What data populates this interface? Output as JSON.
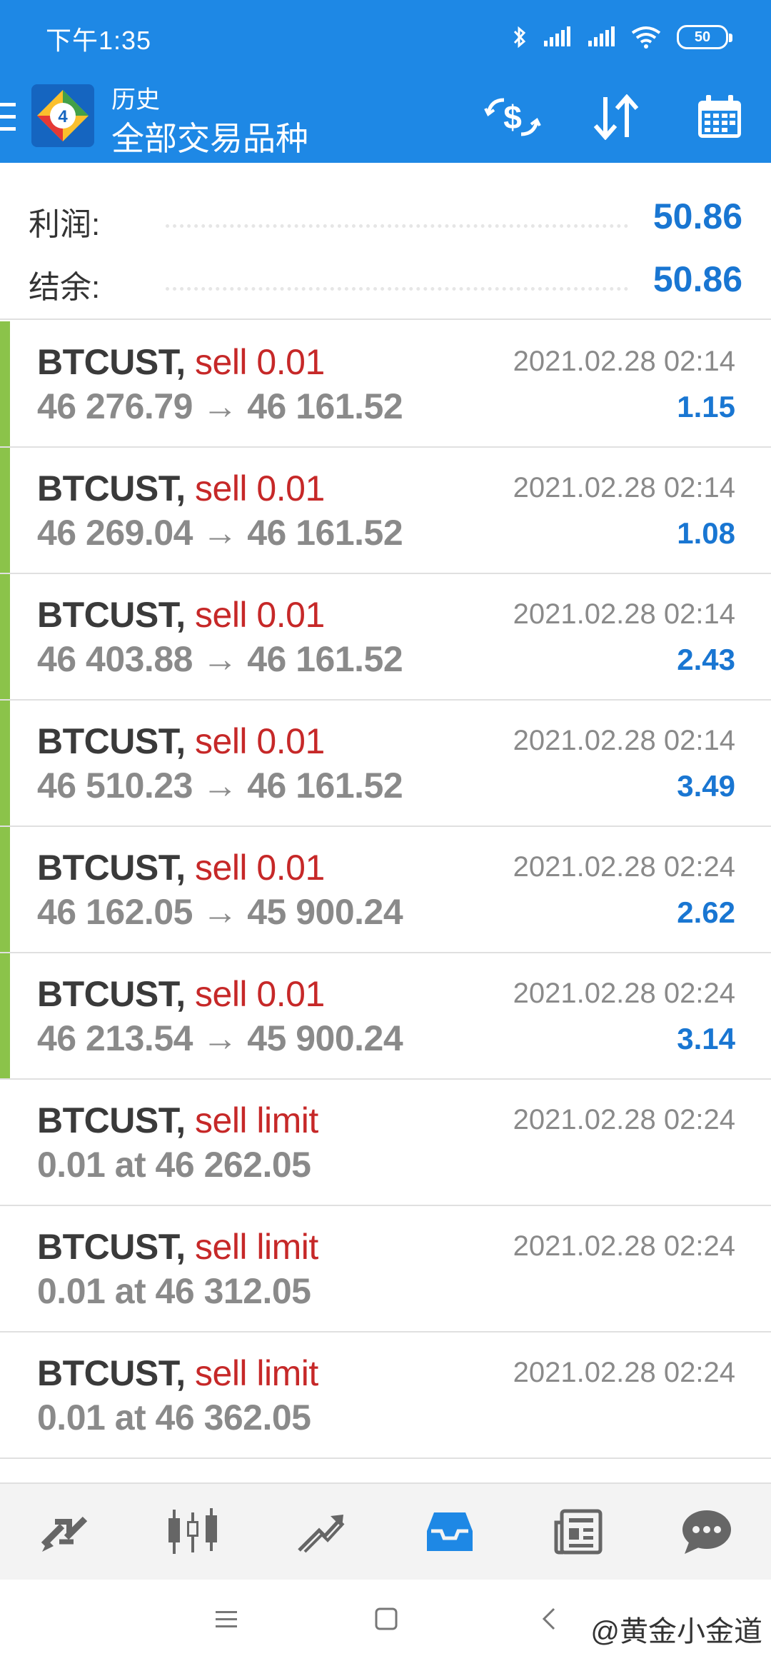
{
  "status_bar": {
    "time": "下午1:35",
    "battery": "50",
    "icons": [
      "bluetooth-icon",
      "signal-icon",
      "signal-icon",
      "wifi-icon",
      "battery-icon"
    ]
  },
  "header": {
    "subtitle": "历史",
    "title": "全部交易品种",
    "actions": [
      "currency-exchange-icon",
      "sort-icon",
      "calendar-icon"
    ]
  },
  "summary": {
    "profit_label": "利润:",
    "profit_value": "50.86",
    "balance_label": "结余:",
    "balance_value": "50.86"
  },
  "deals": [
    {
      "symbol": "BTCUST,",
      "action": "sell 0.01",
      "prices": "46 276.79 → 46 161.52",
      "time": "2021.02.28 02:14",
      "profit": "1.15"
    },
    {
      "symbol": "BTCUST,",
      "action": "sell 0.01",
      "prices": "46 269.04 → 46 161.52",
      "time": "2021.02.28 02:14",
      "profit": "1.08"
    },
    {
      "symbol": "BTCUST,",
      "action": "sell 0.01",
      "prices": "46 403.88 → 46 161.52",
      "time": "2021.02.28 02:14",
      "profit": "2.43"
    },
    {
      "symbol": "BTCUST,",
      "action": "sell 0.01",
      "prices": "46 510.23 → 46 161.52",
      "time": "2021.02.28 02:14",
      "profit": "3.49"
    },
    {
      "symbol": "BTCUST,",
      "action": "sell 0.01",
      "prices": "46 162.05 → 45 900.24",
      "time": "2021.02.28 02:24",
      "profit": "2.62"
    },
    {
      "symbol": "BTCUST,",
      "action": "sell 0.01",
      "prices": "46 213.54 → 45 900.24",
      "time": "2021.02.28 02:24",
      "profit": "3.14"
    }
  ],
  "orders": [
    {
      "symbol": "BTCUST,",
      "action": "sell limit",
      "detail": "0.01 at 46 262.05",
      "time": "2021.02.28 02:24"
    },
    {
      "symbol": "BTCUST,",
      "action": "sell limit",
      "detail": "0.01 at 46 312.05",
      "time": "2021.02.28 02:24"
    },
    {
      "symbol": "BTCUST,",
      "action": "sell limit",
      "detail": "0.01 at 46 362.05",
      "time": "2021.02.28 02:24"
    }
  ],
  "tabbar": [
    "quotes-icon",
    "chart-icon",
    "trade-icon",
    "history-icon",
    "news-icon",
    "chat-icon"
  ],
  "navbar": {
    "watermark": "@黄金小金道"
  },
  "colors": {
    "primary": "#1e88e5",
    "profit": "#1976d2",
    "sell": "#c62828",
    "closed_bar": "#8bc34a"
  }
}
